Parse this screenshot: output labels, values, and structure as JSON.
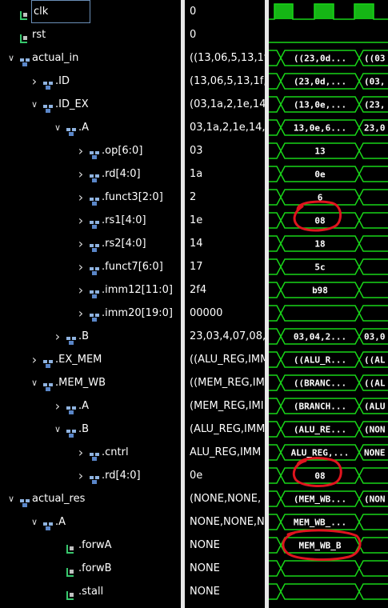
{
  "signals": [
    {
      "label": "clk",
      "value": "0",
      "depth": 0,
      "arrow": "",
      "icon": "bit",
      "selected": true
    },
    {
      "label": "rst",
      "value": "0",
      "depth": 0,
      "arrow": "",
      "icon": "bit"
    },
    {
      "label": "actual_in",
      "value": "((13,06,5,13,1f,",
      "depth": 0,
      "arrow": "down",
      "icon": "struct"
    },
    {
      "label": ".ID",
      "value": "(13,06,5,13,1f,0",
      "depth": 1,
      "arrow": "right",
      "icon": "struct"
    },
    {
      "label": ".ID_EX",
      "value": "(03,1a,2,1e,14,",
      "depth": 1,
      "arrow": "down",
      "icon": "struct"
    },
    {
      "label": ".A",
      "value": "03,1a,2,1e,14,1",
      "depth": 2,
      "arrow": "down",
      "icon": "struct"
    },
    {
      "label": ".op[6:0]",
      "value": "03",
      "depth": 3,
      "arrow": "right",
      "icon": "struct"
    },
    {
      "label": ".rd[4:0]",
      "value": "1a",
      "depth": 3,
      "arrow": "right",
      "icon": "struct"
    },
    {
      "label": ".funct3[2:0]",
      "value": "2",
      "depth": 3,
      "arrow": "right",
      "icon": "struct"
    },
    {
      "label": ".rs1[4:0]",
      "value": "1e",
      "depth": 3,
      "arrow": "right",
      "icon": "struct"
    },
    {
      "label": ".rs2[4:0]",
      "value": "14",
      "depth": 3,
      "arrow": "right",
      "icon": "struct"
    },
    {
      "label": ".funct7[6:0]",
      "value": "17",
      "depth": 3,
      "arrow": "right",
      "icon": "struct"
    },
    {
      "label": ".imm12[11:0]",
      "value": "2f4",
      "depth": 3,
      "arrow": "right",
      "icon": "struct"
    },
    {
      "label": ".imm20[19:0]",
      "value": "00000",
      "depth": 3,
      "arrow": "right",
      "icon": "struct"
    },
    {
      "label": ".B",
      "value": "23,03,4,07,08,3",
      "depth": 2,
      "arrow": "right",
      "icon": "struct"
    },
    {
      "label": ".EX_MEM",
      "value": "((ALU_REG,IMM",
      "depth": 1,
      "arrow": "right",
      "icon": "struct"
    },
    {
      "label": ".MEM_WB",
      "value": "((MEM_REG,IM",
      "depth": 1,
      "arrow": "down",
      "icon": "struct"
    },
    {
      "label": ".A",
      "value": "(MEM_REG,IMI",
      "depth": 2,
      "arrow": "right",
      "icon": "struct"
    },
    {
      "label": ".B",
      "value": "(ALU_REG,IMM",
      "depth": 2,
      "arrow": "down",
      "icon": "struct"
    },
    {
      "label": ".cntrl",
      "value": "ALU_REG,IMM",
      "depth": 3,
      "arrow": "right",
      "icon": "struct"
    },
    {
      "label": ".rd[4:0]",
      "value": "0e",
      "depth": 3,
      "arrow": "right",
      "icon": "struct"
    },
    {
      "label": "actual_res",
      "value": "(NONE,NONE,",
      "depth": 0,
      "arrow": "down",
      "icon": "struct"
    },
    {
      "label": ".A",
      "value": "NONE,NONE,N",
      "depth": 1,
      "arrow": "down",
      "icon": "struct"
    },
    {
      "label": ".forwA",
      "value": "NONE",
      "depth": 2,
      "arrow": "",
      "icon": "bit"
    },
    {
      "label": ".forwB",
      "value": "NONE",
      "depth": 2,
      "arrow": "",
      "icon": "bit"
    },
    {
      "label": ".stall",
      "value": "NONE",
      "depth": 2,
      "arrow": "",
      "icon": "bit"
    }
  ],
  "waves": [
    {
      "kind": "clock"
    },
    {
      "kind": "flat"
    },
    {
      "kind": "bus",
      "segs": [
        "((23,0d...",
        "((03"
      ]
    },
    {
      "kind": "bus",
      "segs": [
        "(23,0d,...",
        "(03,"
      ]
    },
    {
      "kind": "bus",
      "segs": [
        "(13,0e,...",
        "(23,"
      ]
    },
    {
      "kind": "bus",
      "segs": [
        "13,0e,6...",
        "23,0"
      ]
    },
    {
      "kind": "bus",
      "segs": [
        "13",
        ""
      ]
    },
    {
      "kind": "bus",
      "segs": [
        "0e",
        ""
      ]
    },
    {
      "kind": "bus",
      "segs": [
        "6",
        ""
      ]
    },
    {
      "kind": "bus",
      "segs": [
        "08",
        ""
      ]
    },
    {
      "kind": "bus",
      "segs": [
        "18",
        ""
      ]
    },
    {
      "kind": "bus",
      "segs": [
        "5c",
        ""
      ]
    },
    {
      "kind": "bus",
      "segs": [
        "b98",
        ""
      ]
    },
    {
      "kind": "bus",
      "segs": [
        "",
        ""
      ]
    },
    {
      "kind": "bus",
      "segs": [
        "03,04,2...",
        "03,0"
      ]
    },
    {
      "kind": "bus",
      "segs": [
        "((ALU_R...",
        "((AL"
      ]
    },
    {
      "kind": "bus",
      "segs": [
        "((BRANC...",
        "((AL"
      ]
    },
    {
      "kind": "bus",
      "segs": [
        "(BRANCH...",
        "(ALU"
      ]
    },
    {
      "kind": "bus",
      "segs": [
        "(ALU_RE...",
        "(NON"
      ]
    },
    {
      "kind": "bus",
      "segs": [
        "ALU_REG,...",
        "NONE"
      ]
    },
    {
      "kind": "bus",
      "segs": [
        "08",
        ""
      ]
    },
    {
      "kind": "bus",
      "segs": [
        "(MEM_WB...",
        "(NON"
      ]
    },
    {
      "kind": "bus",
      "segs": [
        "MEM_WB_...",
        ""
      ]
    },
    {
      "kind": "bus",
      "segs": [
        "MEM_WB_B",
        ""
      ]
    },
    {
      "kind": "bus",
      "segs": [
        "",
        ""
      ]
    },
    {
      "kind": "bus",
      "segs": [
        "",
        ""
      ]
    }
  ],
  "colors": {
    "wave": "#19d619",
    "annotation": "#e0141e",
    "text": "#ffffff",
    "background": "#000000"
  }
}
